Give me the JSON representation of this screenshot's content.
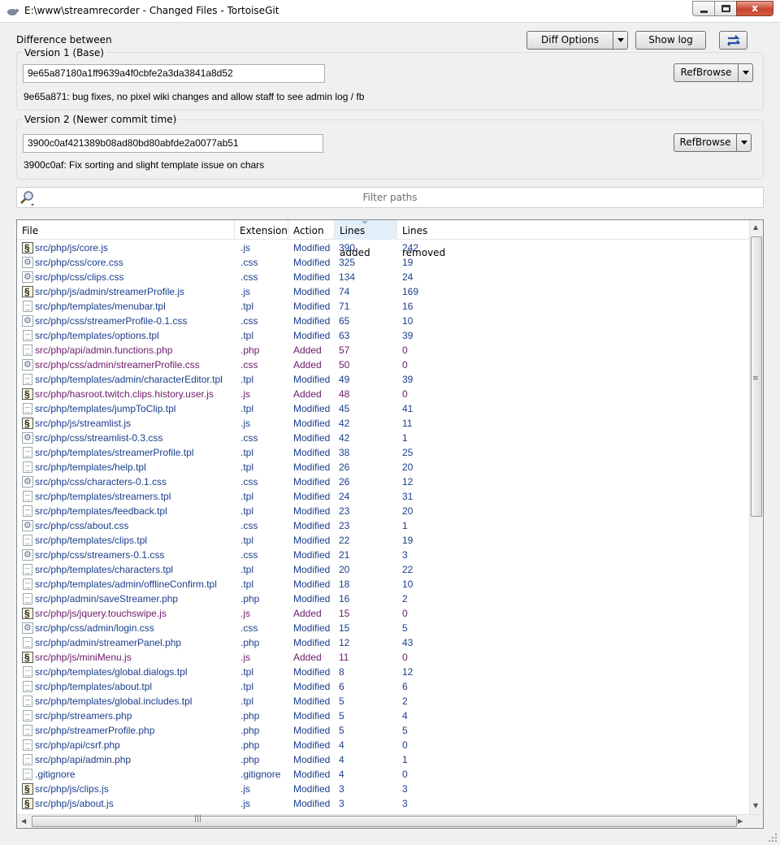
{
  "window": {
    "title": "E:\\www\\streamrecorder - Changed Files - TortoiseGit",
    "close_glyph": "x"
  },
  "top": {
    "difference_label": "Difference between",
    "diff_options_label": "Diff Options",
    "show_log_label": "Show log"
  },
  "version1": {
    "legend": "Version 1 (Base)",
    "hash": "9e65a87180a1ff9639a4f0cbfe2a3da3841a8d52",
    "message": "9e65a871: bug fixes, no pixel wiki changes and allow staff to see admin log / fb",
    "refbrowse_label": "RefBrowse"
  },
  "version2": {
    "legend": "Version 2 (Newer commit time)",
    "hash": "3900c0af421389b08ad80bd80abfde2a0077ab51",
    "message": "3900c0af: Fix sorting and slight template issue on chars",
    "refbrowse_label": "RefBrowse"
  },
  "filter": {
    "placeholder": "Filter paths"
  },
  "colors": {
    "modified": "#1a3e8c",
    "added": "#6b1a6b"
  },
  "list": {
    "columns": [
      "File",
      "Extension",
      "Action",
      "Lines added",
      "Lines removed"
    ],
    "sorted_column": "Lines added",
    "rows": [
      {
        "file": "src/php/js/core.js",
        "ext": ".js",
        "action": "Modified",
        "added": "390",
        "removed": "242",
        "icon": "js"
      },
      {
        "file": "src/php/css/core.css",
        "ext": ".css",
        "action": "Modified",
        "added": "325",
        "removed": "19",
        "icon": "css"
      },
      {
        "file": "src/php/css/clips.css",
        "ext": ".css",
        "action": "Modified",
        "added": "134",
        "removed": "24",
        "icon": "css"
      },
      {
        "file": "src/php/js/admin/streamerProfile.js",
        "ext": ".js",
        "action": "Modified",
        "added": "74",
        "removed": "169",
        "icon": "js"
      },
      {
        "file": "src/php/templates/menubar.tpl",
        "ext": ".tpl",
        "action": "Modified",
        "added": "71",
        "removed": "16",
        "icon": "tpl"
      },
      {
        "file": "src/php/css/streamerProfile-0.1.css",
        "ext": ".css",
        "action": "Modified",
        "added": "65",
        "removed": "10",
        "icon": "css"
      },
      {
        "file": "src/php/templates/options.tpl",
        "ext": ".tpl",
        "action": "Modified",
        "added": "63",
        "removed": "39",
        "icon": "tpl"
      },
      {
        "file": "src/php/api/admin.functions.php",
        "ext": ".php",
        "action": "Added",
        "added": "57",
        "removed": "0",
        "icon": "php"
      },
      {
        "file": "src/php/css/admin/streamerProfile.css",
        "ext": ".css",
        "action": "Added",
        "added": "50",
        "removed": "0",
        "icon": "css"
      },
      {
        "file": "src/php/templates/admin/characterEditor.tpl",
        "ext": ".tpl",
        "action": "Modified",
        "added": "49",
        "removed": "39",
        "icon": "tpl"
      },
      {
        "file": "src/php/hasroot.twitch.clips.history.user.js",
        "ext": ".js",
        "action": "Added",
        "added": "48",
        "removed": "0",
        "icon": "js"
      },
      {
        "file": "src/php/templates/jumpToClip.tpl",
        "ext": ".tpl",
        "action": "Modified",
        "added": "45",
        "removed": "41",
        "icon": "tpl"
      },
      {
        "file": "src/php/js/streamlist.js",
        "ext": ".js",
        "action": "Modified",
        "added": "42",
        "removed": "11",
        "icon": "js"
      },
      {
        "file": "src/php/css/streamlist-0.3.css",
        "ext": ".css",
        "action": "Modified",
        "added": "42",
        "removed": "1",
        "icon": "css"
      },
      {
        "file": "src/php/templates/streamerProfile.tpl",
        "ext": ".tpl",
        "action": "Modified",
        "added": "38",
        "removed": "25",
        "icon": "tpl"
      },
      {
        "file": "src/php/templates/help.tpl",
        "ext": ".tpl",
        "action": "Modified",
        "added": "26",
        "removed": "20",
        "icon": "tpl"
      },
      {
        "file": "src/php/css/characters-0.1.css",
        "ext": ".css",
        "action": "Modified",
        "added": "26",
        "removed": "12",
        "icon": "css"
      },
      {
        "file": "src/php/templates/streamers.tpl",
        "ext": ".tpl",
        "action": "Modified",
        "added": "24",
        "removed": "31",
        "icon": "tpl"
      },
      {
        "file": "src/php/templates/feedback.tpl",
        "ext": ".tpl",
        "action": "Modified",
        "added": "23",
        "removed": "20",
        "icon": "tpl"
      },
      {
        "file": "src/php/css/about.css",
        "ext": ".css",
        "action": "Modified",
        "added": "23",
        "removed": "1",
        "icon": "css"
      },
      {
        "file": "src/php/templates/clips.tpl",
        "ext": ".tpl",
        "action": "Modified",
        "added": "22",
        "removed": "19",
        "icon": "tpl"
      },
      {
        "file": "src/php/css/streamers-0.1.css",
        "ext": ".css",
        "action": "Modified",
        "added": "21",
        "removed": "3",
        "icon": "css"
      },
      {
        "file": "src/php/templates/characters.tpl",
        "ext": ".tpl",
        "action": "Modified",
        "added": "20",
        "removed": "22",
        "icon": "tpl"
      },
      {
        "file": "src/php/templates/admin/offlineConfirm.tpl",
        "ext": ".tpl",
        "action": "Modified",
        "added": "18",
        "removed": "10",
        "icon": "tpl"
      },
      {
        "file": "src/php/admin/saveStreamer.php",
        "ext": ".php",
        "action": "Modified",
        "added": "16",
        "removed": "2",
        "icon": "php"
      },
      {
        "file": "src/php/js/jquery.touchswipe.js",
        "ext": ".js",
        "action": "Added",
        "added": "15",
        "removed": "0",
        "icon": "js"
      },
      {
        "file": "src/php/css/admin/login.css",
        "ext": ".css",
        "action": "Modified",
        "added": "15",
        "removed": "5",
        "icon": "css"
      },
      {
        "file": "src/php/admin/streamerPanel.php",
        "ext": ".php",
        "action": "Modified",
        "added": "12",
        "removed": "43",
        "icon": "php"
      },
      {
        "file": "src/php/js/miniMenu.js",
        "ext": ".js",
        "action": "Added",
        "added": "11",
        "removed": "0",
        "icon": "js"
      },
      {
        "file": "src/php/templates/global.dialogs.tpl",
        "ext": ".tpl",
        "action": "Modified",
        "added": "8",
        "removed": "12",
        "icon": "tpl"
      },
      {
        "file": "src/php/templates/about.tpl",
        "ext": ".tpl",
        "action": "Modified",
        "added": "6",
        "removed": "6",
        "icon": "tpl"
      },
      {
        "file": "src/php/templates/global.includes.tpl",
        "ext": ".tpl",
        "action": "Modified",
        "added": "5",
        "removed": "2",
        "icon": "tpl"
      },
      {
        "file": "src/php/streamers.php",
        "ext": ".php",
        "action": "Modified",
        "added": "5",
        "removed": "4",
        "icon": "php"
      },
      {
        "file": "src/php/streamerProfile.php",
        "ext": ".php",
        "action": "Modified",
        "added": "5",
        "removed": "5",
        "icon": "php"
      },
      {
        "file": "src/php/api/csrf.php",
        "ext": ".php",
        "action": "Modified",
        "added": "4",
        "removed": "0",
        "icon": "php"
      },
      {
        "file": "src/php/api/admin.php",
        "ext": ".php",
        "action": "Modified",
        "added": "4",
        "removed": "1",
        "icon": "php"
      },
      {
        "file": ".gitignore",
        "ext": ".gitignore",
        "action": "Modified",
        "added": "4",
        "removed": "0",
        "icon": "doc"
      },
      {
        "file": "src/php/js/clips.js",
        "ext": ".js",
        "action": "Modified",
        "added": "3",
        "removed": "3",
        "icon": "js"
      },
      {
        "file": "src/php/js/about.js",
        "ext": ".js",
        "action": "Modified",
        "added": "3",
        "removed": "3",
        "icon": "js"
      }
    ]
  }
}
